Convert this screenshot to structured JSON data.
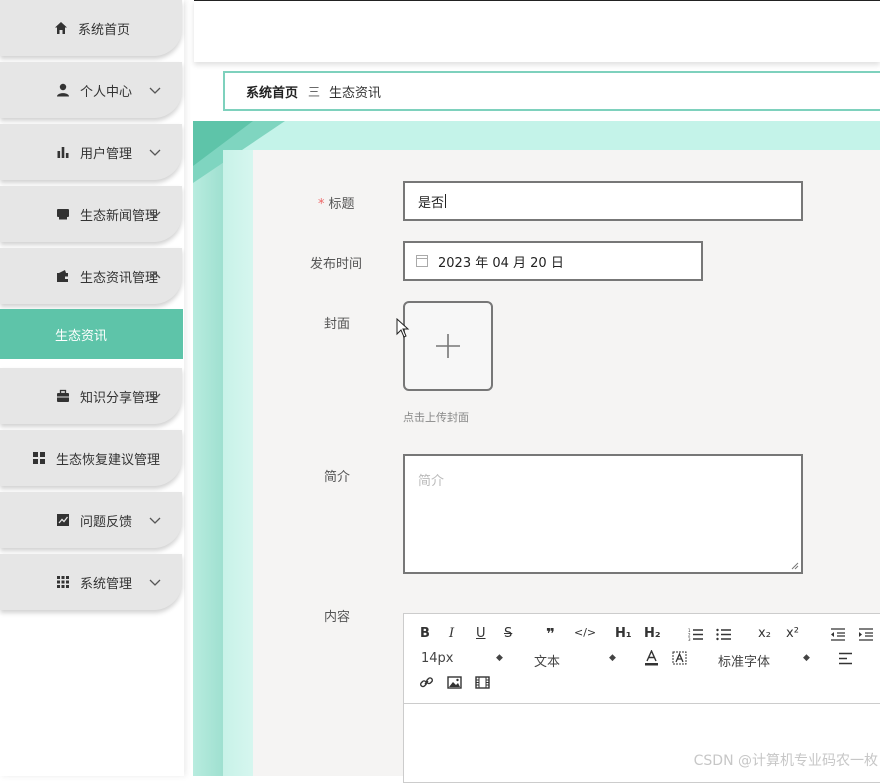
{
  "sidebar": {
    "items": [
      {
        "label": "系统首页",
        "icon": "home-icon"
      },
      {
        "label": "个人中心",
        "icon": "user-icon"
      },
      {
        "label": "用户管理",
        "icon": "bar-chart-icon"
      },
      {
        "label": "生态新闻管理",
        "icon": "inbox-icon"
      },
      {
        "label": "生态资讯管理",
        "icon": "wallet-icon"
      },
      {
        "label": "知识分享管理",
        "icon": "briefcase-icon"
      },
      {
        "label": "生态恢复建议管理",
        "icon": "grid-icon"
      },
      {
        "label": "问题反馈",
        "icon": "trend-chart-icon"
      },
      {
        "label": "系统管理",
        "icon": "apps-icon"
      }
    ],
    "active_sub": "生态资讯"
  },
  "breadcrumb": {
    "home": "系统首页",
    "separator": "三",
    "current": "生态资讯"
  },
  "form": {
    "title_label": "标题",
    "title_required_mark": "*",
    "title_value": "是否",
    "date_label": "发布时间",
    "date_value": "2023 年 04 月 20 日",
    "cover_label": "封面",
    "cover_hint": "点击上传封面",
    "intro_label": "简介",
    "intro_placeholder": "简介",
    "content_label": "内容"
  },
  "editor": {
    "font_size": "14px",
    "paragraph": "文本",
    "font_family": "标准字体"
  },
  "watermark": "CSDN @计算机专业码农一枚",
  "colors": {
    "accent": "#5ec4a9",
    "frame": "#c4f3e9",
    "border": "#7ed1bd"
  }
}
